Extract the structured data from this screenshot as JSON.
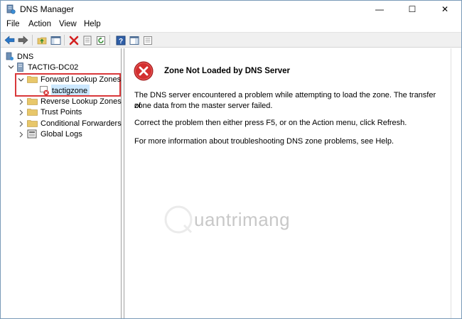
{
  "window": {
    "title": "DNS Manager",
    "controls": {
      "minimize": "—",
      "maximize": "☐",
      "close": "✕"
    }
  },
  "menu": [
    "File",
    "Action",
    "View",
    "Help"
  ],
  "toolbar": {
    "buttons": [
      "back-arrow-icon",
      "forward-arrow-icon",
      "up-folder-icon",
      "show-hide-tree-icon",
      "delete-icon",
      "properties-icon",
      "refresh-icon",
      "export-list-icon",
      "help-icon",
      "show-pane-icon"
    ]
  },
  "tree": {
    "root": "DNS",
    "server": "TACTIG-DC02",
    "forward_zones": "Forward Lookup Zones",
    "zone": "tactigzone",
    "reverse_zones": "Reverse Lookup Zones",
    "trust_points": "Trust Points",
    "conditional_forwarders": "Conditional Forwarders",
    "global_logs": "Global Logs"
  },
  "content": {
    "heading": "Zone Not Loaded by DNS Server",
    "para1_line1": "The DNS server encountered a problem while attempting to load the zone. The transfer of",
    "para1_line2": "zone data from the master server failed.",
    "para2": "Correct the problem then either press F5, or on the Action menu, click Refresh.",
    "para3": "For more information about troubleshooting DNS zone problems, see Help."
  },
  "watermark": "uantrimang",
  "colors": {
    "error_red": "#d32f2f",
    "highlight_red": "#d9383a",
    "selection": "#cce8ff",
    "folder": "#e8c76a"
  }
}
